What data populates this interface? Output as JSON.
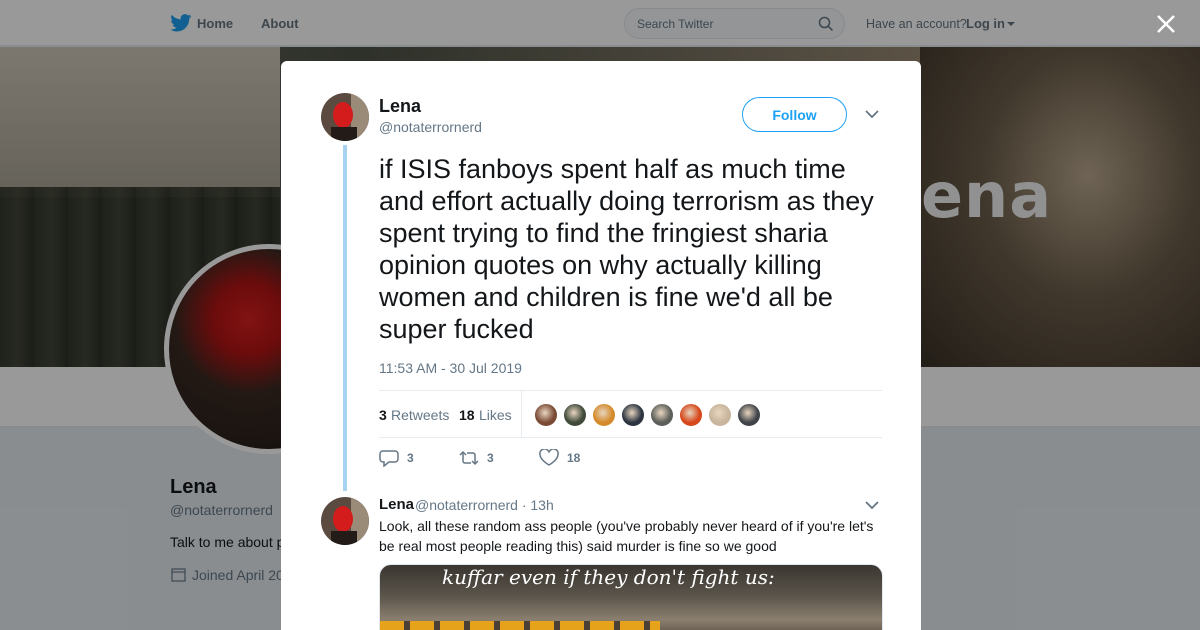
{
  "nav": {
    "home_label": "Home",
    "about_label": "About",
    "search_placeholder": "Search Twitter",
    "have_account": "Have an account?",
    "login_label": "Log in"
  },
  "profile": {
    "banner_text": "ena",
    "name": "Lena",
    "handle": "@notaterrornerd",
    "bio_visible": "Talk to me about p",
    "joined_visible": "Joined April 20"
  },
  "tweet": {
    "author_name": "Lena",
    "author_handle": "@notaterrornerd",
    "follow_label": "Follow",
    "text": "if ISIS fanboys spent half as much time and effort actually doing terrorism as they spent trying to find the fringiest sharia opinion quotes on why actually killing women and children is fine we'd all be super fucked",
    "timestamp": "11:53 AM - 30 Jul 2019",
    "retweets_count": "3",
    "retweets_label": "Retweets",
    "likes_count": "18",
    "likes_label": "Likes",
    "likers_colors": [
      "#7a4a35",
      "#3f4a3a",
      "#d48a2a",
      "#2c3440",
      "#5c5f5a",
      "#d6471a",
      "#c9b59d",
      "#404449"
    ],
    "reply_count": "3",
    "retweet_action_count": "3",
    "like_action_count": "18"
  },
  "reply": {
    "author_name": "Lena",
    "meta": "@notaterrornerd · 13h",
    "text": "Look, all these random ass people (you've probably never heard of if you're let's be real most people reading this) said murder is fine so we good",
    "media_caption": "kuffar even if they don't fight us:"
  },
  "colors": {
    "accent": "#1da1f2",
    "thread_line": "#a6d3f2",
    "muted_text": "#657786"
  }
}
